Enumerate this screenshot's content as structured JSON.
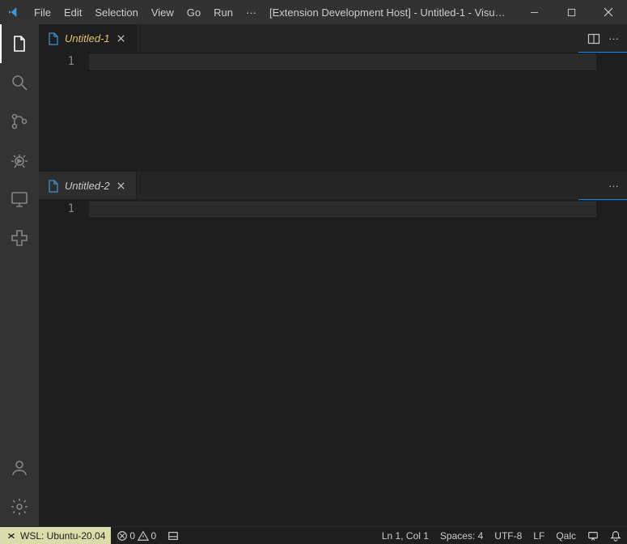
{
  "titlebar": {
    "menus": [
      "File",
      "Edit",
      "Selection",
      "View",
      "Go",
      "Run",
      "···"
    ],
    "title": "[Extension Development Host] - Untitled-1 - Visual ..."
  },
  "editorGroups": {
    "top": {
      "tab": {
        "label": "Untitled-1"
      },
      "line_number": "1"
    },
    "bottom": {
      "tab": {
        "label": "Untitled-2"
      },
      "line_number": "1"
    }
  },
  "statusbar": {
    "remote": "WSL: Ubuntu-20.04",
    "errors": "0",
    "warnings": "0",
    "position": "Ln 1, Col 1",
    "spaces": "Spaces: 4",
    "encoding": "UTF-8",
    "eol": "LF",
    "language": "Qalc"
  }
}
